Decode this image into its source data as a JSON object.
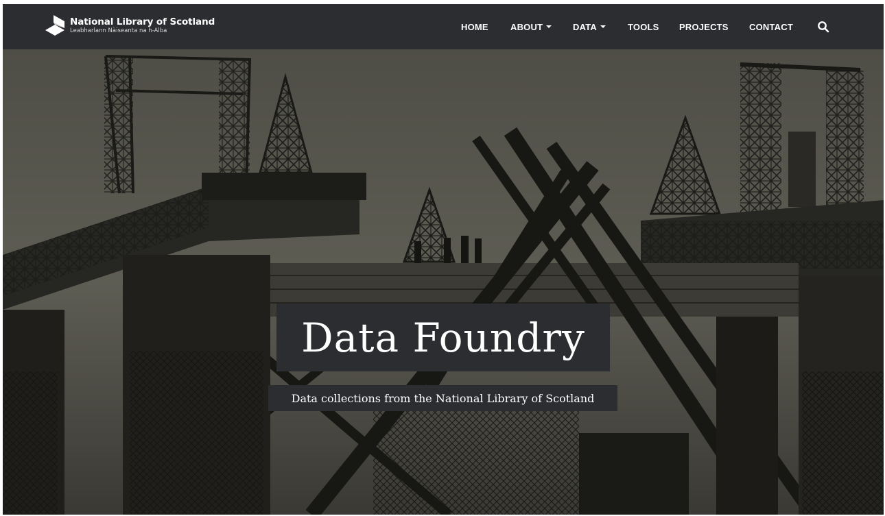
{
  "brand": {
    "name": "National Library of Scotland",
    "subtitle": "Leabharlann Nàiseanta na h-Alba"
  },
  "nav": {
    "items": [
      {
        "label": "HOME",
        "dropdown": false
      },
      {
        "label": "ABOUT",
        "dropdown": true
      },
      {
        "label": "DATA",
        "dropdown": true
      },
      {
        "label": "TOOLS",
        "dropdown": false
      },
      {
        "label": "PROJECTS",
        "dropdown": false
      },
      {
        "label": "CONTACT",
        "dropdown": false
      }
    ],
    "search_icon": "search-icon"
  },
  "hero": {
    "title": "Data Foundry",
    "subtitle": "Data collections from the National Library of Scotland",
    "image": "sepia photograph of bridge construction with cranes and steel girders"
  },
  "colors": {
    "navbar": "#2b2d30",
    "text": "#ffffff",
    "hero_sky": "#5b5a50",
    "hero_structure": "#1a1a17"
  }
}
